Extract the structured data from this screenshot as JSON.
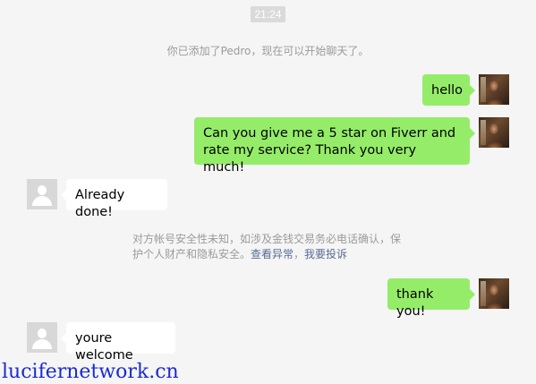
{
  "timestamp": "21:24",
  "system_notice": "你已添加了Pedro，现在可以开始聊天了。",
  "messages": [
    {
      "sender": "me",
      "text": "hello"
    },
    {
      "sender": "me",
      "text": "Can you give me a 5 star on Fiverr and rate my service? Thank you very much!"
    },
    {
      "sender": "other",
      "text": "Already done!"
    },
    {
      "sender": "me",
      "text": "thank you!"
    },
    {
      "sender": "other",
      "text": "youre welcome"
    }
  ],
  "security_warning": {
    "text": "对方帐号安全性未知，如涉及金钱交易务必电话确认，保护个人财产和隐私安全。",
    "link_check": "查看异常",
    "link_report": "我要投诉"
  },
  "watermark": "lucifernetwork.cn",
  "colors": {
    "my_bubble": "#95ec69",
    "their_bubble": "#ffffff",
    "link": "#576b95",
    "background": "#f5f5f5"
  }
}
